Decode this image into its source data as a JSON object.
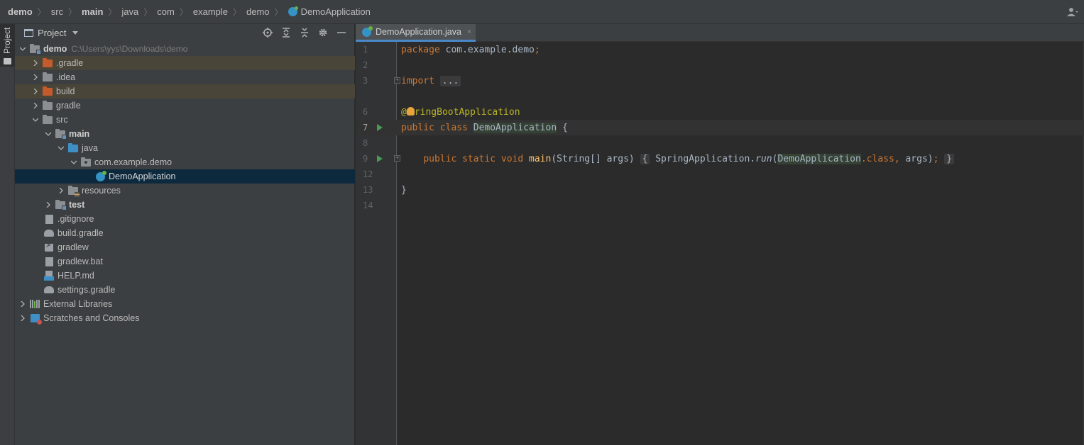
{
  "breadcrumb": {
    "items": [
      {
        "label": "demo",
        "bold": true
      },
      {
        "label": "src",
        "bold": false
      },
      {
        "label": "main",
        "bold": true
      },
      {
        "label": "java",
        "bold": false
      },
      {
        "label": "com",
        "bold": false
      },
      {
        "label": "example",
        "bold": false
      },
      {
        "label": "demo",
        "bold": false
      },
      {
        "label": "DemoApplication",
        "bold": false
      }
    ]
  },
  "stripe": {
    "project_label": "Project"
  },
  "project_panel": {
    "title": "Project",
    "tools": [
      "locate-icon",
      "expand-all-icon",
      "collapse-all-icon",
      "gear-icon",
      "minimize-icon"
    ]
  },
  "tree": {
    "root": {
      "label": "demo",
      "path": "C:\\Users\\yys\\Downloads\\demo"
    },
    "gradle_hidden": ".gradle",
    "idea": ".idea",
    "build": "build",
    "gradle": "gradle",
    "src": "src",
    "main": "main",
    "java": "java",
    "package": "com.example.demo",
    "demo_app": "DemoApplication",
    "resources": "resources",
    "test": "test",
    "gitignore": ".gitignore",
    "build_gradle": "build.gradle",
    "gradlew": "gradlew",
    "gradlew_bat": "gradlew.bat",
    "help_md": "HELP.md",
    "settings_gradle": "settings.gradle",
    "external_libraries": "External Libraries",
    "scratches": "Scratches and Consoles"
  },
  "editor": {
    "tab_label": "DemoApplication.java",
    "tab_close": "×",
    "line_numbers": [
      "1",
      "2",
      "3",
      "6",
      "7",
      "8",
      "9",
      "12",
      "13",
      "14"
    ],
    "code": {
      "l1_kw": "package",
      "l1_rest": " com.example.demo",
      "l1_semi": ";",
      "l3_kw": "import",
      "l3_fold": "...",
      "l6_at": "@",
      "l6_rest": "ringBootApplication",
      "l7_kw": "public class",
      "l7_cls": "DemoApplication",
      "l7_rest": " {",
      "l9_kw": "public static void",
      "l9_fn": "main",
      "l9_params": "(String[] args)",
      "l9_open": "{",
      "l9_call": "SpringApplication.",
      "l9_run": "run",
      "l9_paren": "(",
      "l9_cls": "DemoApplication",
      "l9_dotclass": ".class,",
      "l9_args": " args)",
      "l9_semi": ";",
      "l9_close": "}",
      "l13": "}"
    }
  }
}
